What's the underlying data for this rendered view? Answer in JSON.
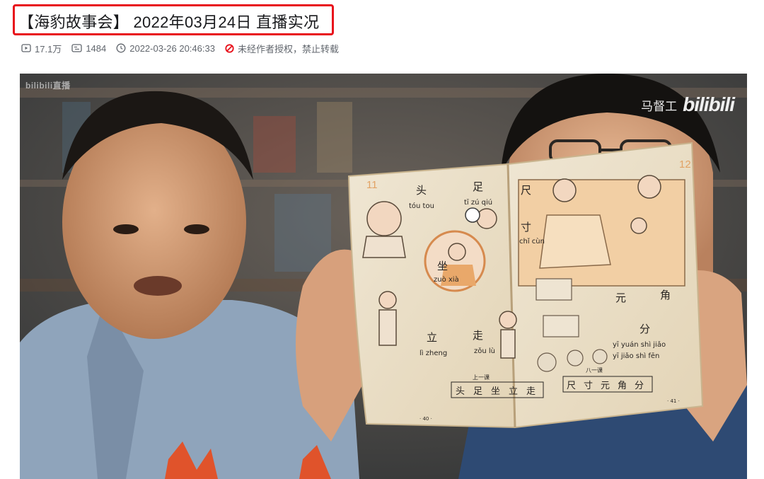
{
  "video": {
    "title": "【海豹故事会】 2022年03月24日 直播实况",
    "views": "17.1万",
    "danmaku": "1484",
    "publish_time": "2022-03-26 20:46:33",
    "copyright_notice": "未经作者授权，禁止转载"
  },
  "player": {
    "watermark_left": "bilibili直播",
    "uploader_watermark": "马督工",
    "logo_text": "bilibili"
  },
  "book": {
    "page_left": "11",
    "page_right": "12",
    "words_left": [
      {
        "hanzi": "头",
        "pinyin": "tóu"
      },
      {
        "hanzi": "足",
        "pinyin": "zú"
      },
      {
        "hanzi": "坐",
        "pinyin": "zuò"
      },
      {
        "hanzi": "立",
        "pinyin": "lì"
      },
      {
        "hanzi": "走",
        "pinyin": "zǒu"
      }
    ],
    "phrases_left": [
      "tóu tou",
      "tī zú qiú",
      "zuò xià",
      "lì zheng",
      "zǒu lù"
    ],
    "words_right": [
      {
        "hanzi": "尺",
        "pinyin": "chǐ"
      },
      {
        "hanzi": "寸",
        "pinyin": "cùn"
      },
      {
        "hanzi": "元",
        "pinyin": "yuán"
      },
      {
        "hanzi": "角",
        "pinyin": "jiǎo"
      },
      {
        "hanzi": "分",
        "pinyin": "fēn"
      }
    ],
    "phrases_right": [
      "chǐ cùn",
      "yī yuán shì jiǎo",
      "yī jiǎo shì fēn"
    ],
    "lesson_left": "上一课",
    "lesson_right": "八一课",
    "review_left": [
      "头",
      "足",
      "坐",
      "立",
      "走"
    ],
    "review_right": [
      "尺",
      "寸",
      "元",
      "角",
      "分"
    ],
    "page_num_left": "· 40 ·",
    "page_num_right": "· 41 ·"
  },
  "colors": {
    "highlight_border": "#e8111b",
    "meta_text": "#61666d",
    "warn_icon": "#e8111b"
  },
  "icons": {
    "views": "play-icon",
    "danmaku": "danmaku-icon",
    "time": "clock-icon",
    "copyright": "no-repost-icon"
  }
}
